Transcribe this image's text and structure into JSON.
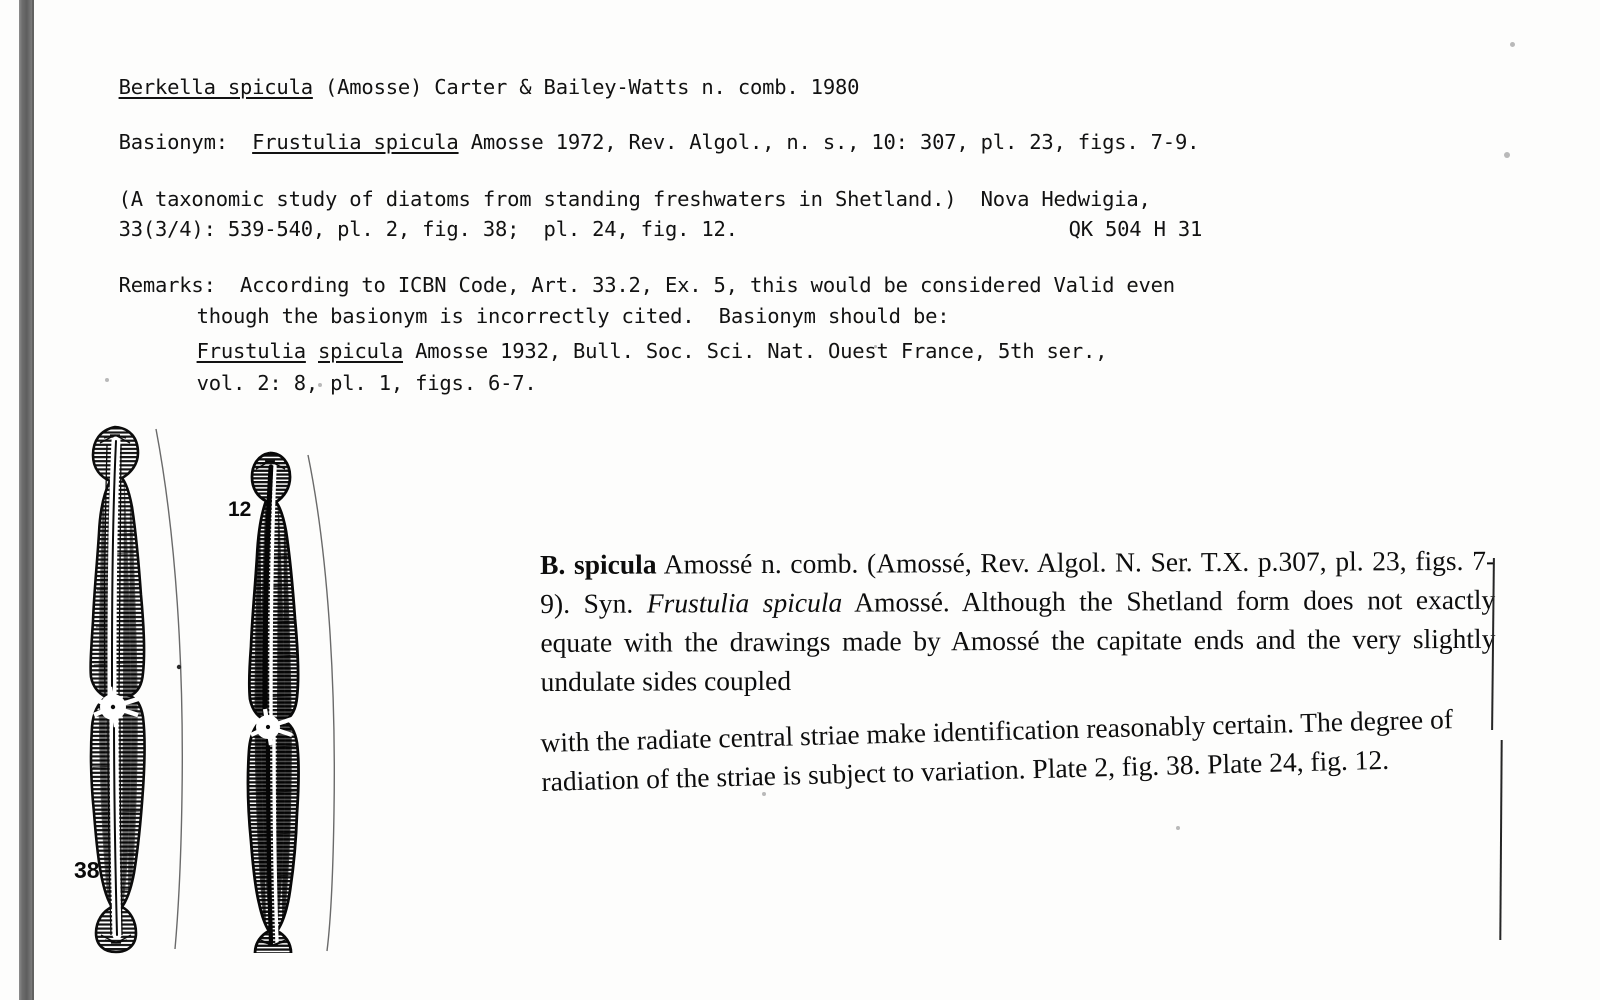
{
  "document": {
    "type": "taxonomic-index-card",
    "heading": {
      "genus_species": "Berkella spicula",
      "authority": " (Amosse) Carter & Bailey-Watts n. comb. 1980"
    },
    "basionym": {
      "label": "Basionym:  ",
      "name": "Frustulia spicula",
      "citation": " Amosse 1972, Rev. Algol., n. s., 10: 307, pl. 23, figs. 7-9."
    },
    "source": {
      "line1": "(A taxonomic study of diatoms from standing freshwaters in Shetland.)  Nova Hedwigia,",
      "line2": "33(3/4): 539-540, pl. 2, fig. 38;  pl. 24, fig. 12.",
      "call_number": "QK 504 H 31"
    },
    "remarks": {
      "line1": "Remarks:  According to ICBN Code, Art. 33.2, Ex. 5, this would be considered Valid even",
      "line2": "though the basionym is incorrectly cited.  Basionym should be:",
      "line3_name_1": "Frustulia",
      "line3_name_2": "spicula",
      "line3_rest": " Amosse 1932, Bull. Soc. Sci. Nat. Ouest France, 5th ser.,",
      "line4": "vol. 2: 8, pl. 1, figs. 6-7."
    }
  },
  "clipping": {
    "paragraph_1": {
      "lead_abbrev": "B.",
      "lead_species": " spicula",
      "text_a": " Amossé n. comb. (Amossé, Rev. Algol. N. Ser. T.X. p.307, pl. 23, figs. 7-9). Syn. ",
      "synonym": "Frustulia spicula",
      "text_b": " Amossé. Although the Shetland form does not exactly equate with the drawings made by Amossé the capitate ends and the very slightly undulate sides coupled"
    },
    "paragraph_2": {
      "text": "with the radiate central striae make identification reasonably certain. The degree of radiation of the striae is subject to variation. Plate 2, fig. 38. Plate 24, fig. 12."
    }
  },
  "figures": [
    {
      "label": "38",
      "caption_ref": "Plate 2, fig. 38",
      "description": "diatom valve, capitate ends, radiate central striae, stellate central area"
    },
    {
      "label": "12",
      "caption_ref": "Plate 24, fig. 12",
      "description": "diatom valve, narrower, darker, capitate ends, stellate central area"
    }
  ],
  "colors": {
    "ink": "#121212",
    "paper": "#fdfdfc",
    "scan_edge": "#6d6d6d"
  }
}
